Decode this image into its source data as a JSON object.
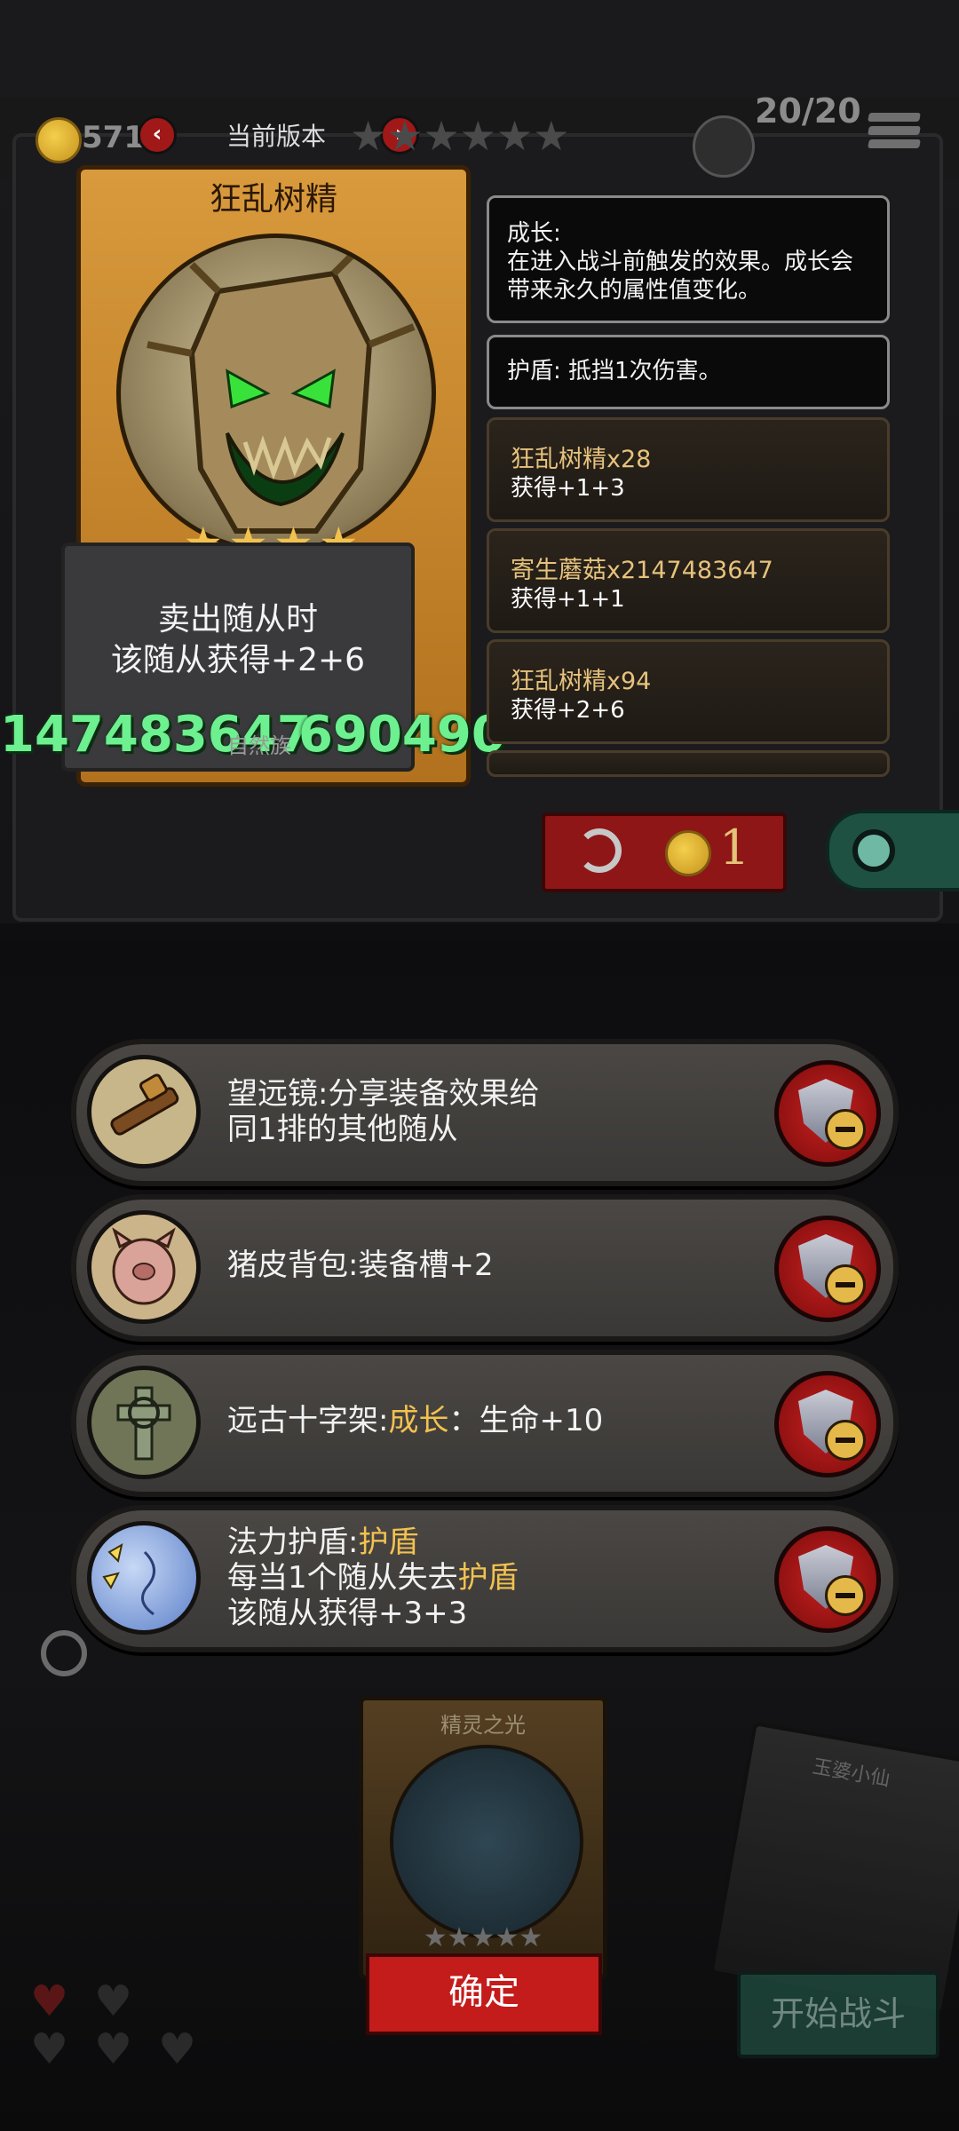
{
  "top_bar": {
    "coins": "571",
    "prev_arrow": "‹",
    "next_arrow": "›",
    "version_label": "当前版本",
    "capacity": "20/20"
  },
  "card": {
    "name": "狂乱树精",
    "stars": 4,
    "stars_display": "★★★★",
    "description_line1": "卖出随从时",
    "description_line2": "该随从获得+2+6",
    "big_left_number": "147483647",
    "big_right_number": "690490",
    "tag_label": "自然族"
  },
  "info_panel": {
    "keyword_growth": "成长:",
    "keyword_growth_desc_1": "在进入战斗前触发的效果。成长会",
    "keyword_growth_desc_2": "带来永久的属性值变化。",
    "keyword_shield": "护盾: 抵挡1次伤害。",
    "logs": [
      {
        "name": "狂乱树精x28",
        "gain": "获得+1+3"
      },
      {
        "name": "寄生蘑菇x2147483647",
        "gain": "获得+1+1"
      },
      {
        "name": "狂乱树精x94",
        "gain": "获得+2+6"
      }
    ]
  },
  "refresh": {
    "cost": "1"
  },
  "equipment": [
    {
      "icon": "telescope-icon",
      "name": "望远镜:",
      "text_line1": "分享装备效果给",
      "text_line2": "同1排的其他随从"
    },
    {
      "icon": "pig-backpack-icon",
      "name": "猪皮背包:",
      "text_line1": "装备槽+2"
    },
    {
      "icon": "ancient-cross-icon",
      "name": "远古十字架:",
      "keyword": "成长",
      "text_line1": "：生命+10"
    },
    {
      "icon": "mana-shield-icon",
      "name": "法力护盾:",
      "keyword": "护盾",
      "line2_prefix": "每当1个随从失去",
      "line2_keyword": "护盾",
      "line3": "该随从获得+3+3"
    }
  ],
  "bottom": {
    "card_name": "精灵之光",
    "card_stars": "★★★★★",
    "side_card_name": "玉婆小仙",
    "confirm_label": "确定",
    "start_battle_label": "开始战斗"
  },
  "colors": {
    "accent_red": "#c41b1b",
    "keyword_gold": "#f2c24f",
    "number_green": "#6df08f"
  }
}
